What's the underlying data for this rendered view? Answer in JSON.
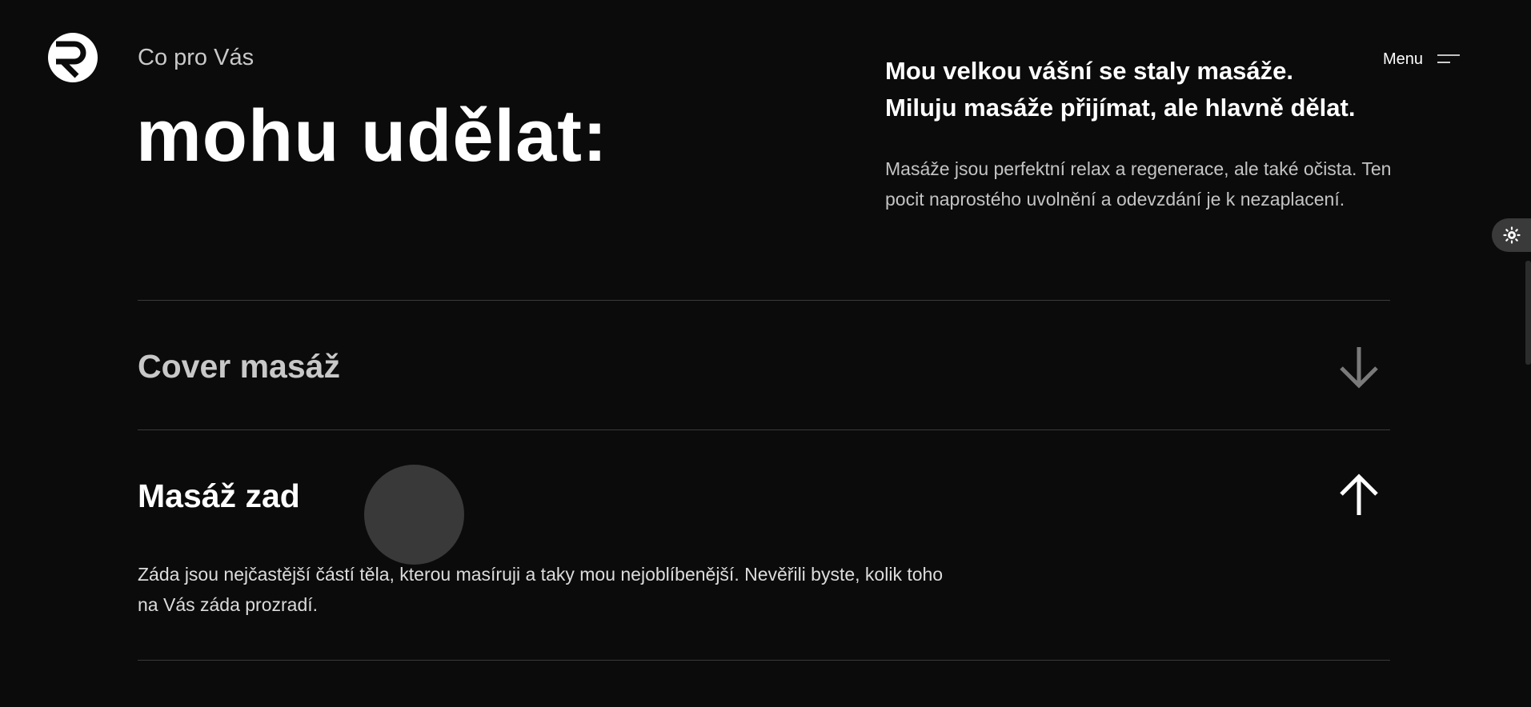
{
  "header": {
    "eyebrow": "Co pro Vás",
    "headline": "mohu udělat:",
    "menu_label": "Menu"
  },
  "intro": {
    "strong_line_1": "Mou velkou vášní se staly masáže.",
    "strong_line_2": "Miluju masáže přijímat, ale hlavně dělat.",
    "paragraph": "Masáže jsou perfektní relax a regenerace, ale také očista. Ten pocit naprostého uvolnění a odevzdání je k nezaplacení."
  },
  "services": [
    {
      "title": "Cover masáž",
      "state": "collapsed",
      "icon": "arrow-down-icon"
    },
    {
      "title": "Masáž zad",
      "state": "expanded",
      "icon": "arrow-up-icon",
      "description": "Záda jsou nejčastější částí těla, kterou masíruji a taky mou nejoblíbenější. Nevěřili byste, kolik toho na Vás záda prozradí."
    }
  ],
  "theme_toggle": {
    "icon": "sun-icon"
  },
  "colors": {
    "background": "#0b0b0b",
    "text": "#ffffff",
    "muted_text": "#c4c4c4",
    "divider": "#3a3a3a",
    "toggle_bg": "#3a3a3a"
  }
}
